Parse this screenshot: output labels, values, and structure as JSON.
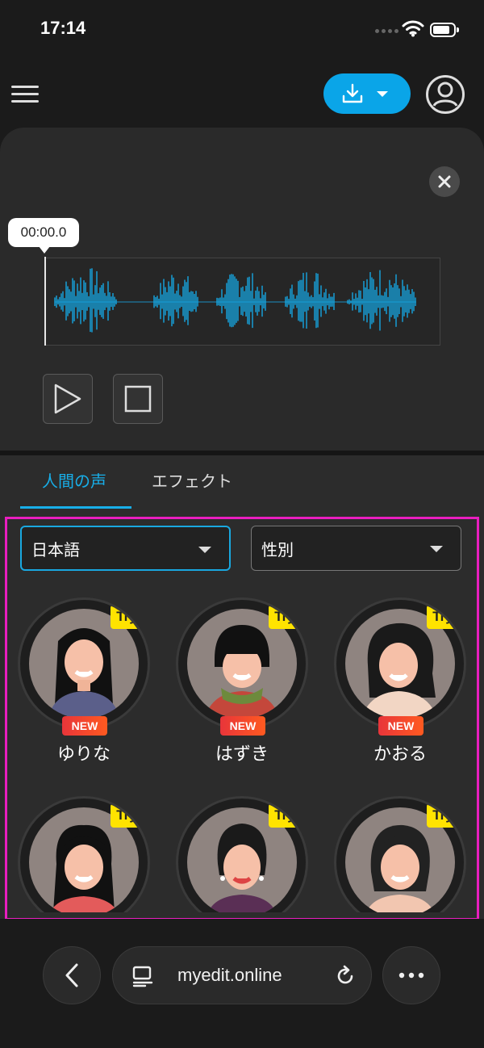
{
  "status_bar": {
    "time": "17:14"
  },
  "editor": {
    "timestamp": "00:00.0"
  },
  "tabs": [
    {
      "label": "人間の声"
    },
    {
      "label": "エフェクト"
    }
  ],
  "filters": {
    "language": "日本語",
    "gender": "性別"
  },
  "voices": [
    {
      "name": "ゆりな",
      "try": "Try",
      "badge": "NEW"
    },
    {
      "name": "はずき",
      "try": "Try",
      "badge": "NEW"
    },
    {
      "name": "かおる",
      "try": "Try",
      "badge": "NEW"
    },
    {
      "name": "",
      "try": "Try",
      "badge": ""
    },
    {
      "name": "",
      "try": "Try",
      "badge": ""
    },
    {
      "name": "",
      "try": "Try",
      "badge": ""
    }
  ],
  "browser": {
    "url": "myedit.online"
  },
  "colors": {
    "accent": "#18aee8",
    "highlight": "#e91ebf",
    "try_badge": "#ffe300"
  }
}
